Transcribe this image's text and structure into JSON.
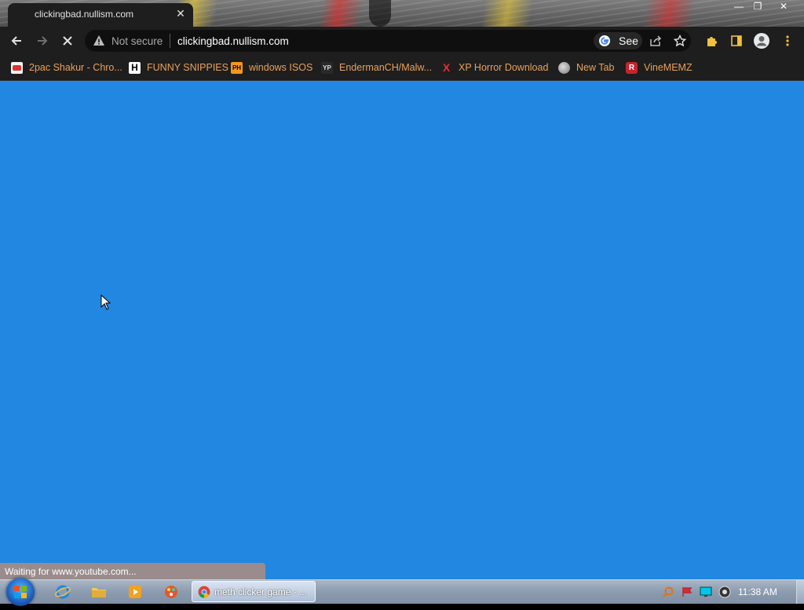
{
  "tab": {
    "title": "clickingbad.nullism.com",
    "close_glyph": "✕",
    "new_tab_glyph": "+"
  },
  "window_controls": {
    "minimize": "—",
    "maximize": "❐",
    "close": "✕"
  },
  "toolbar": {
    "security_label": "Not secure",
    "url": "clickingbad.nullism.com",
    "google_chip_label": "See"
  },
  "bookmarks": [
    {
      "label": "2pac Shakur - Chro...",
      "icon": "lunchbox-favicon"
    },
    {
      "label": "FUNNY SNIPPIES",
      "icon": "h-favicon",
      "icon_text": "H"
    },
    {
      "label": "windows ISOS",
      "icon": "ph-favicon",
      "icon_text": "PH"
    },
    {
      "label": "EndermanCH/Malw...",
      "icon": "github-favicon",
      "icon_text": "YP"
    },
    {
      "label": "XP Horror Download",
      "icon": "x-favicon",
      "icon_text": "X"
    },
    {
      "label": "New Tab",
      "icon": "globe-favicon"
    },
    {
      "label": "VineMEMZ",
      "icon": "r-favicon",
      "icon_text": "R"
    }
  ],
  "status_text": "Waiting for www.youtube.com...",
  "taskbar": {
    "chrome_task_label": "meth clicker game - ...",
    "clock": "11:38 AM"
  },
  "colors": {
    "page_background": "#2287e0",
    "browser_chrome": "#1e1e1e",
    "bookmark_text": "#e9a15a"
  }
}
